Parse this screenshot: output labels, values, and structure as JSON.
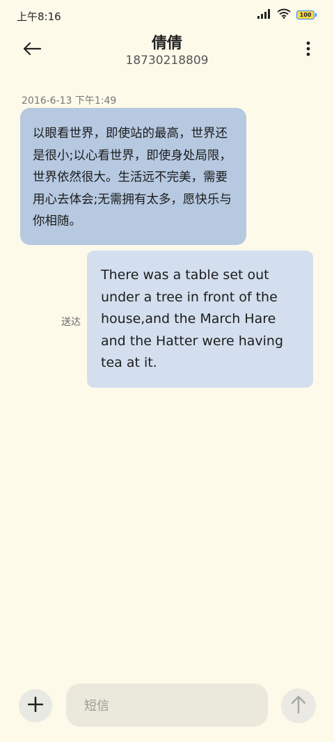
{
  "status_bar": {
    "time": "上午8:16",
    "battery_level": "100"
  },
  "header": {
    "contact_name": "倩倩",
    "phone_number": "18730218809"
  },
  "conversation": {
    "timestamp": "2016-6-13 下午1:49",
    "messages": [
      {
        "direction": "incoming",
        "text": "以眼看世界，即使站的最高，世界还是很小;以心看世界，即使身处局限，世界依然很大。生活远不完美，需要用心去体会;无需拥有太多，愿快乐与你相随。"
      },
      {
        "direction": "outgoing",
        "text": "There was a table set out under a tree in front of the house,and the March Hare and the Hatter were having tea at it.",
        "status": "送达"
      }
    ]
  },
  "compose": {
    "placeholder": "短信"
  },
  "colors": {
    "background": "#fdfaea",
    "incoming_bubble": "#b6c9e1",
    "outgoing_bubble": "#d3dfee"
  }
}
